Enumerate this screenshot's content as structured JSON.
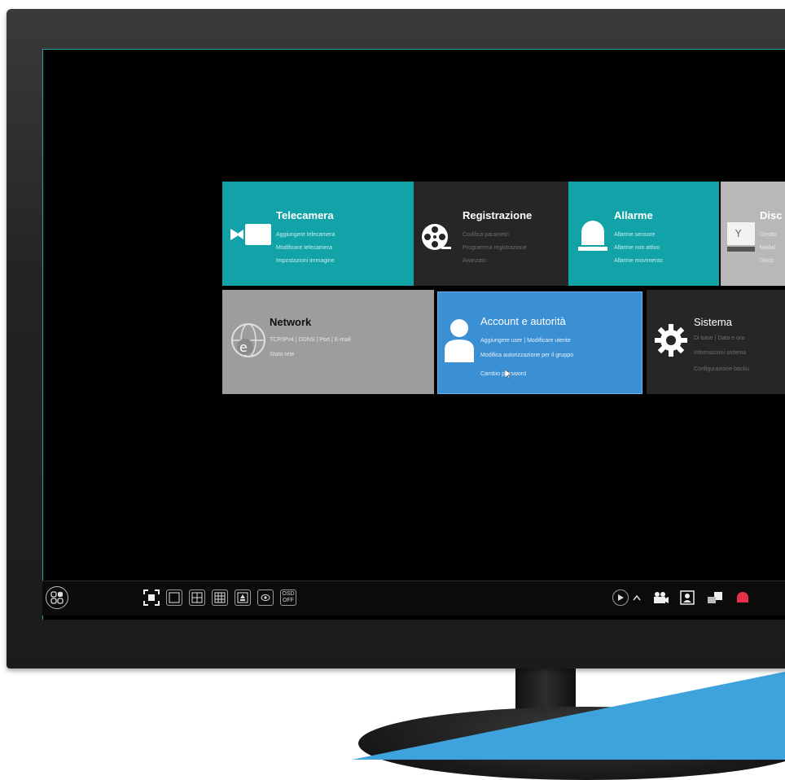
{
  "tiles": {
    "telecamera": {
      "title": "Telecamera",
      "items": [
        "Aggiungere telecamera",
        "Modificare telecamera",
        "Impostazioni immagine"
      ],
      "icon": "camera-icon"
    },
    "registrazione": {
      "title": "Registrazione",
      "items": [
        "Codifica parametri",
        "Programma registrazione",
        "Avanzato"
      ],
      "icon": "film-reel-icon"
    },
    "allarme": {
      "title": "Allarme",
      "items": [
        "Allarme sensore",
        "Allarme non attivo",
        "Allarme movimento"
      ],
      "icon": "alarm-light-icon"
    },
    "disco": {
      "title": "Disc",
      "items": [
        "Gestio",
        "Modal",
        "Disco"
      ],
      "icon": "disk-icon"
    },
    "network": {
      "title": "Network",
      "items": [
        "TCP/IPv4 | DDNS | Port | E-mail",
        "Stato rete"
      ],
      "icon": "network-globe-icon"
    },
    "account": {
      "title": "Account e autorità",
      "items": [
        "Aggiungere user | Modificare utente",
        "Modifica autorizzazione per il gruppo",
        "Cambio password"
      ],
      "icon": "user-icon"
    },
    "sistema": {
      "title": "Sistema",
      "items": [
        "Di base | Data e ora",
        "Informazioni sistema",
        "Configurazione backu"
      ],
      "icon": "gear-icon"
    }
  },
  "toolbar": {
    "osd_label_top": "OSD",
    "osd_label_bottom": "OFF"
  },
  "colors": {
    "teal": "#12a3a9",
    "dark": "#262626",
    "gray": "#9d9d9d",
    "blue": "#3b8fd3",
    "accent": "#3ea3dd",
    "alarm_red": "#e8304a"
  }
}
